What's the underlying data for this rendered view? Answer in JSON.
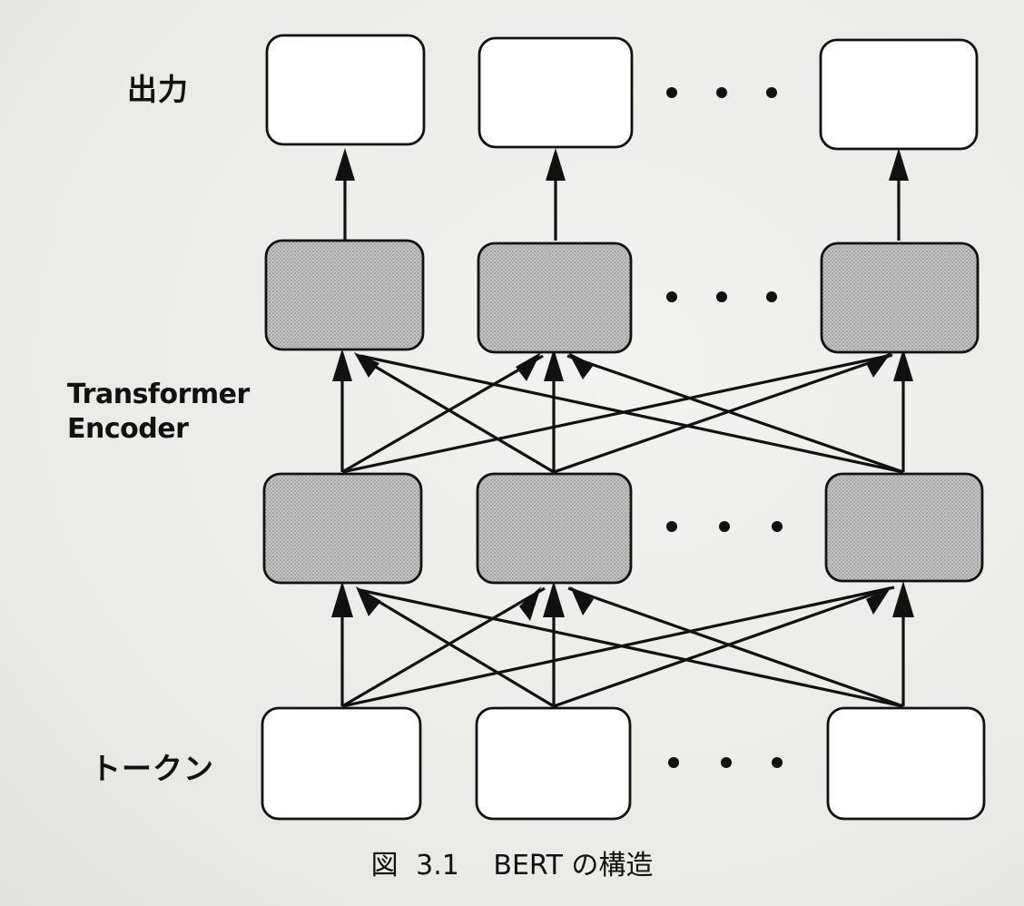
{
  "diagram": {
    "labels": {
      "output": "出力",
      "encoder_line1": "Transformer",
      "encoder_line2": "Encoder",
      "token": "トークン"
    },
    "ellipsis": "・・・",
    "caption": {
      "prefix": "図",
      "number": "3.1",
      "title": "BERT の構造"
    },
    "colors": {
      "box_fill_plain": "#ffffff",
      "box_fill_encoder": "#b9b9b9",
      "stroke": "#111111"
    }
  }
}
